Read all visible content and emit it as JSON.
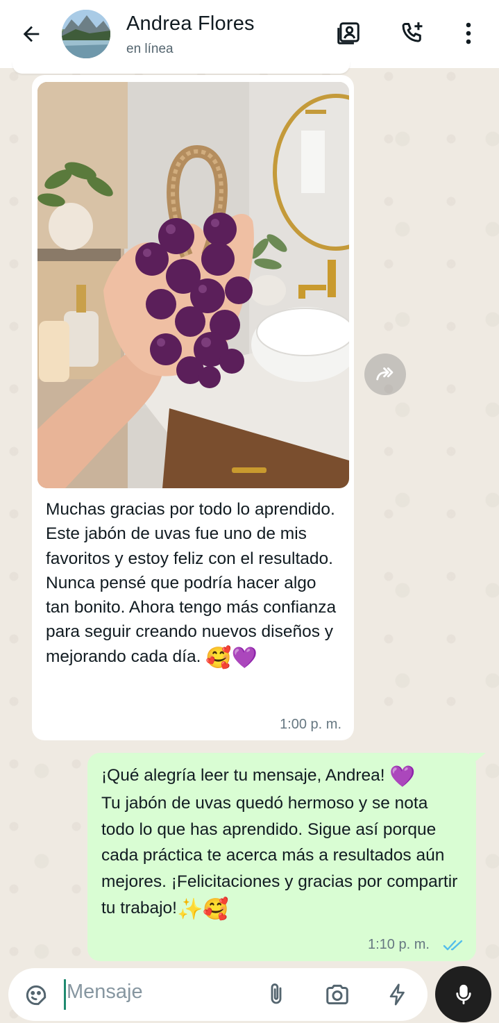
{
  "header": {
    "contact_name": "Andrea Flores",
    "status": "en línea",
    "icons": [
      "back-arrow-icon",
      "contact-card-icon",
      "add-call-icon",
      "more-vert-icon"
    ]
  },
  "messages": [
    {
      "direction": "incoming",
      "has_image": true,
      "image_description_icon": "photo",
      "text": "Muchas gracias por todo lo aprendido. Este jabón de uvas fue uno de mis favoritos y estoy feliz con el resultado. Nunca pensé que podría hacer algo tan bonito. Ahora tengo más confianza para seguir creando nuevos diseños y mejorando cada día.",
      "emojis": "🥰💜",
      "time": "1:00 p. m."
    },
    {
      "direction": "outgoing",
      "text_line1": "¡Qué alegría leer tu mensaje, Andrea!",
      "emoji1": "💜",
      "text_rest": "Tu jabón de uvas quedó hermoso y se nota todo lo que has aprendido. Sigue así porque cada práctica te acerca más a resultados aún mejores. ¡Felicitaciones y gracias por compartir tu trabajo!",
      "emojis_end": "✨🥰",
      "time": "1:10 p. m.",
      "status": "read"
    }
  ],
  "input": {
    "placeholder": "Mensaje"
  },
  "colors": {
    "sent_bubble": "#d9fdd3",
    "read_ticks": "#53bdeb",
    "background": "#efeae2"
  }
}
